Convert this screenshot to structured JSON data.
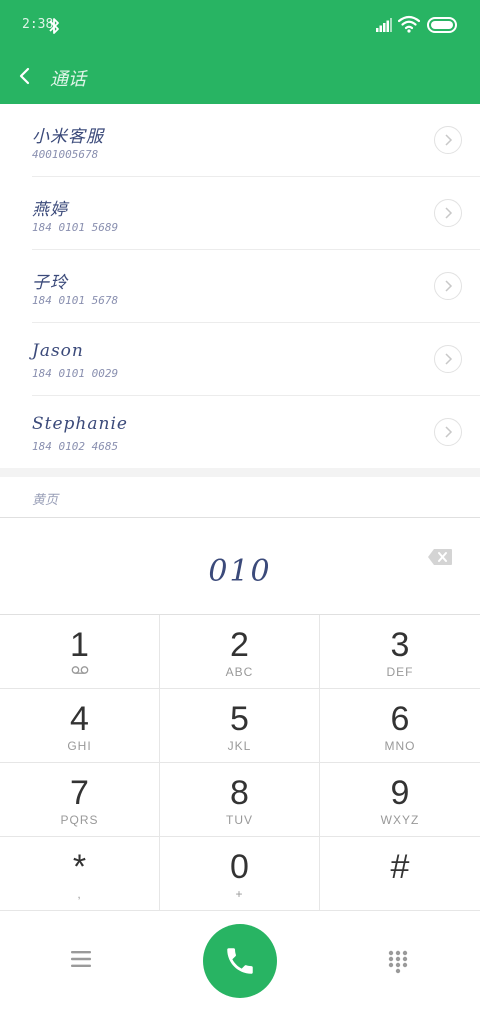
{
  "status_bar": {
    "time": "2:38"
  },
  "header": {
    "title": "通话"
  },
  "contacts": [
    {
      "name": "小米客服",
      "number": "4001005678"
    },
    {
      "name": "燕婷",
      "number": "184 0101 5689"
    },
    {
      "name": "子玲",
      "number": "184 0101 5678"
    },
    {
      "name": "Jason",
      "number": "184 0101 0029"
    },
    {
      "name": "Stephanie",
      "number": "184 0102 4685"
    }
  ],
  "yellow_pages_label": "黄页",
  "dial_input": "010",
  "keys": [
    {
      "digit": "1",
      "letters": ""
    },
    {
      "digit": "2",
      "letters": "ABC"
    },
    {
      "digit": "3",
      "letters": "DEF"
    },
    {
      "digit": "4",
      "letters": "GHI"
    },
    {
      "digit": "5",
      "letters": "JKL"
    },
    {
      "digit": "6",
      "letters": "MNO"
    },
    {
      "digit": "7",
      "letters": "PQRS"
    },
    {
      "digit": "8",
      "letters": "TUV"
    },
    {
      "digit": "9",
      "letters": "WXYZ"
    },
    {
      "digit": "*",
      "letters": ","
    },
    {
      "digit": "0",
      "letters": "+"
    },
    {
      "digit": "#",
      "letters": ""
    }
  ],
  "colors": {
    "accent": "#28b463",
    "contact_text": "#3b4a7a",
    "separator": "#e6e6e6"
  },
  "icons": {
    "back": "back-chevron-icon",
    "voicemail": "voicemail-icon",
    "backspace": "backspace-icon",
    "menu": "menu-icon",
    "call": "phone-icon",
    "keypad_toggle": "keypad-icon"
  }
}
